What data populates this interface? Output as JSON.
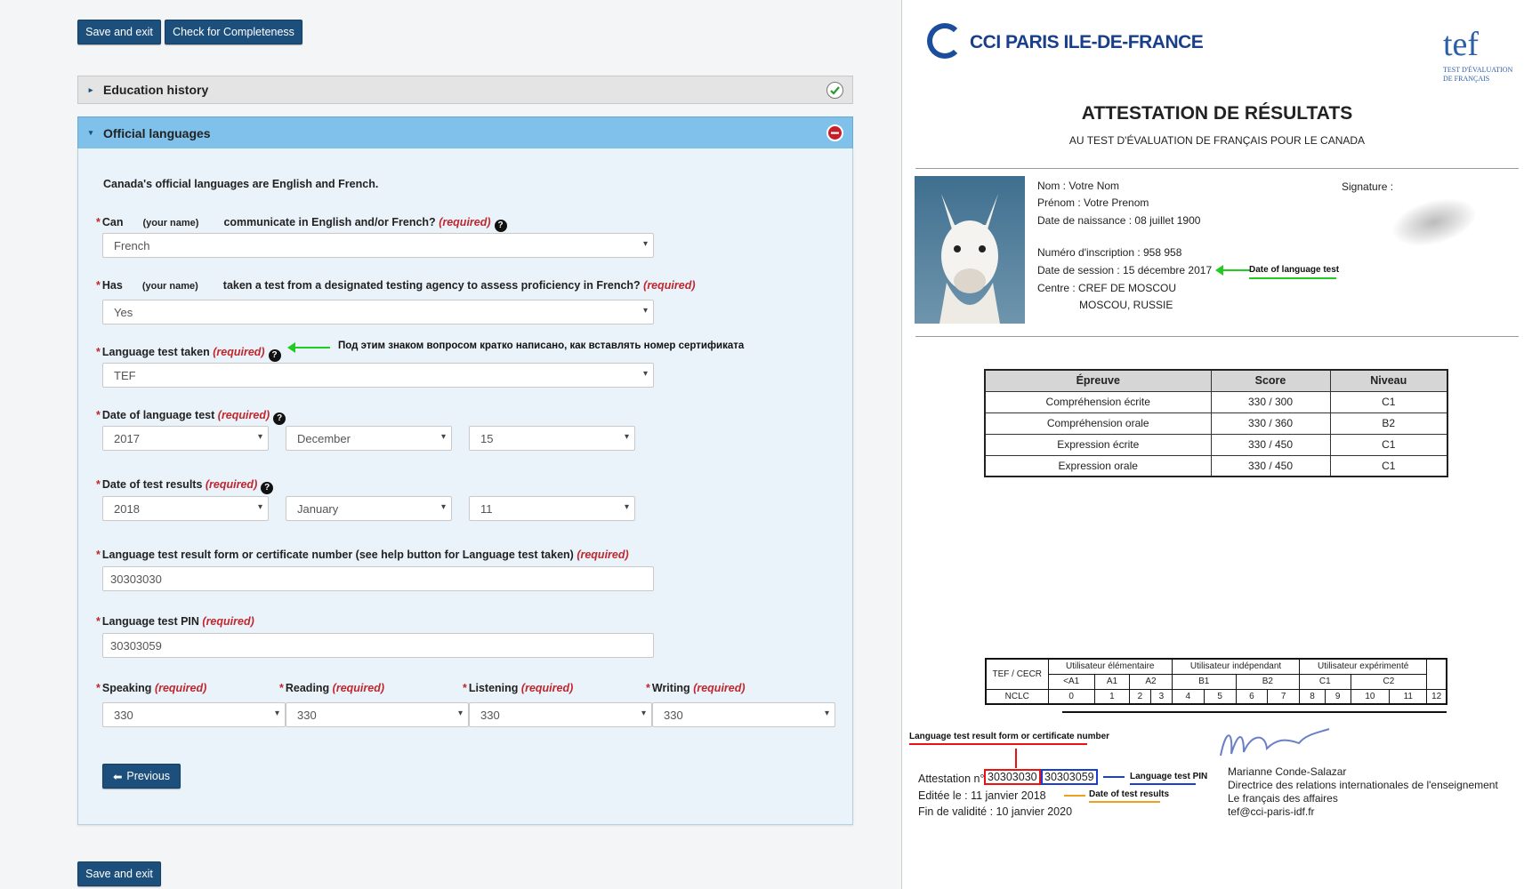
{
  "toolbar": {
    "save_exit": "Save and exit",
    "check": "Check for Completeness",
    "save_exit_bottom": "Save and exit"
  },
  "panels": {
    "education": "Education history",
    "official": "Official languages"
  },
  "form": {
    "intro": "Canada's official languages are English and French.",
    "required": "(required)",
    "your_name": "(your name)",
    "q1": {
      "pre": "Can",
      "post": "communicate in English and/or French?",
      "value": "French"
    },
    "q2": {
      "pre": "Has",
      "post": "taken a test from a designated testing agency to assess proficiency in French?",
      "value": "Yes"
    },
    "q3": {
      "label": "Language test taken",
      "value": "TEF"
    },
    "q4": {
      "label": "Date of language test",
      "year": "2017",
      "month": "December",
      "day": "15"
    },
    "q5": {
      "label": "Date of test results",
      "year": "2018",
      "month": "January",
      "day": "11"
    },
    "q6": {
      "label": "Language test result form or certificate number (see help button for Language test taken)",
      "value": "30303030"
    },
    "q7": {
      "label": "Language test PIN",
      "value": "30303059"
    },
    "scores": [
      {
        "label": "Speaking",
        "value": "330"
      },
      {
        "label": "Reading",
        "value": "330"
      },
      {
        "label": "Listening",
        "value": "330"
      },
      {
        "label": "Writing",
        "value": "330"
      }
    ],
    "previous": "Previous",
    "annotation": "Под этим знаком вопросом  кратко написано, как вставлять номер сертификата"
  },
  "cert": {
    "org": "CCI PARIS ILE-DE-FRANCE",
    "logo": "tef",
    "logo_sub1": "TEST D'ÉVALUATION",
    "logo_sub2": "DE FRANÇAIS",
    "title": "ATTESTATION DE RÉSULTATS",
    "subtitle": "AU TEST D'ÉVALUATION DE FRANÇAIS POUR LE CANADA",
    "nom": "Nom : Votre Nom",
    "prenom": "Prénom : Votre Prenom",
    "naissance": "Date de naissance : 08 juillet 1900",
    "signature": "Signature :",
    "inscription": "Numéro d'inscription : 958 958",
    "session": "Date de session :  15 décembre 2017",
    "centre": "Centre : CREF DE MOSCOU",
    "ville": "MOSCOU, RUSSIE",
    "ann_session": "Date of language test",
    "table_head": [
      "Épreuve",
      "Score",
      "Niveau"
    ],
    "table_rows": [
      [
        "Compréhension écrite",
        "330 / 300",
        "C1"
      ],
      [
        "Compréhension orale",
        "330 / 360",
        "B2"
      ],
      [
        "Expression écrite",
        "330 / 450",
        "C1"
      ],
      [
        "Expression orale",
        "330 / 450",
        "C1"
      ]
    ],
    "scale": {
      "tef": "TEF / CECR",
      "nclc": "NCLC",
      "groups": [
        "Utilisateur élémentaire",
        "Utilisateur indépendant",
        "Utilisateur expérimenté"
      ],
      "levels": [
        "<A1",
        "A1",
        "A2",
        "B1",
        "B2",
        "C1",
        "C2"
      ],
      "nums": [
        "0",
        "1",
        "2",
        "3",
        "4",
        "5",
        "6",
        "7",
        "8",
        "9",
        "10",
        "11",
        "12"
      ]
    },
    "ann_cert": "Language test result form or certificate number",
    "ann_pin": "Language test PIN",
    "ann_results": "Date of test results",
    "attestation": "Attestation n°",
    "att_num": "30303030",
    "att_pin": "30303059",
    "editee": "Editée le :  11 janvier 2018",
    "validite": "Fin de validité :  10 janvier 2020",
    "signer": "Marianne Conde-Salazar",
    "signer_role": "Directrice des relations internationales de l'enseignement",
    "signer_dept": "Le français des affaires",
    "signer_email": "tef@cci-paris-idf.fr"
  }
}
